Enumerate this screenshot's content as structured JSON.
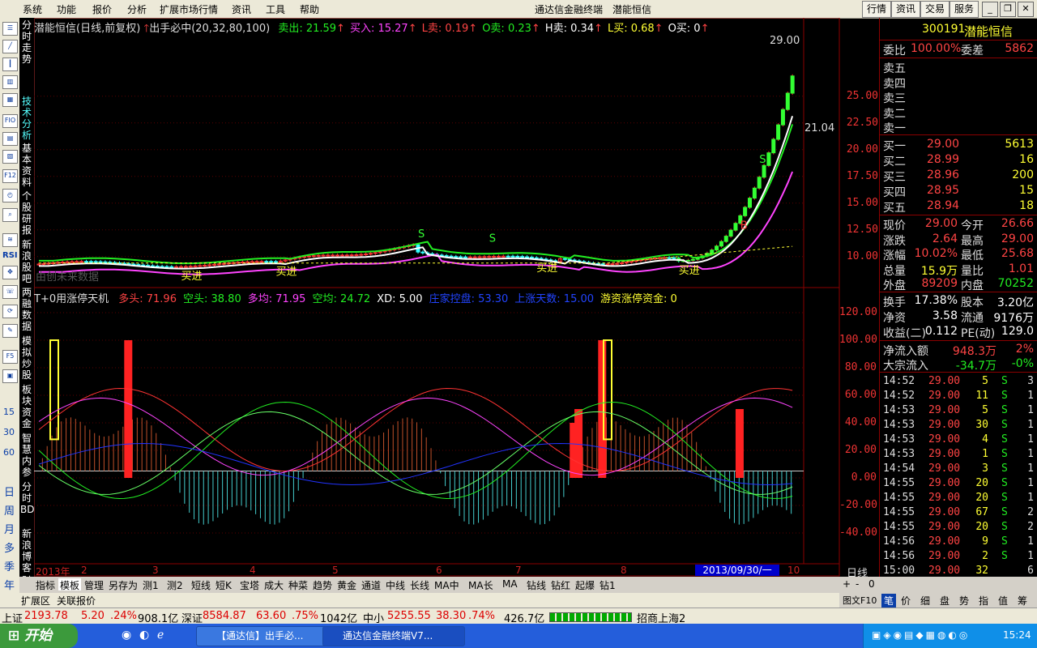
{
  "menu": [
    "系统",
    "功能",
    "报价",
    "分析",
    "扩展市场行情",
    "资讯",
    "工具",
    "帮助"
  ],
  "app_title": "通达信金融终端",
  "stock_title": "潜能恒信",
  "right_buttons": [
    "行情",
    "资讯",
    "交易",
    "服务"
  ],
  "main_header": {
    "name": "潜能恒信(日线,前复权)",
    "indicator": "出手必中(20,32,80,100)",
    "items": [
      {
        "label": "卖出: 21.59",
        "color": "#22ee22"
      },
      {
        "label": "买入: 15.27",
        "color": "#ff44ff"
      },
      {
        "label": "L卖: 0.19",
        "color": "#ff4444"
      },
      {
        "label": "O卖: 0.23",
        "color": "#22ee22"
      },
      {
        "label": "H卖: 0.34",
        "color": "#ffffff"
      },
      {
        "label": "L买: 0.68",
        "color": "#ffff33"
      },
      {
        "label": "O买: 0",
        "color": "#ffffff"
      }
    ]
  },
  "main_labels": {
    "high_price": "29.00",
    "mid_price": "21.04",
    "no_data": "由创未来数据"
  },
  "main_yaxis": [
    "25.00",
    "22.50",
    "20.00",
    "17.50",
    "15.00",
    "12.50",
    "10.00"
  ],
  "ind_header": {
    "name": "T+0用涨停天机",
    "items": [
      {
        "label": "多头: 71.96",
        "color": "#ff4444"
      },
      {
        "label": "空头: 38.80",
        "color": "#22ee22"
      },
      {
        "label": "多均: 71.95",
        "color": "#ff44ff"
      },
      {
        "label": "空均: 24.72",
        "color": "#22ee22"
      },
      {
        "label": "XD: 5.00",
        "color": "#ffffff"
      },
      {
        "label": "庄家控盘: 53.30",
        "color": "#2244ff"
      },
      {
        "label": "上涨天数: 15.00",
        "color": "#2244ff"
      },
      {
        "label": "游资涨停资金: 0",
        "color": "#ffff33"
      }
    ]
  },
  "ind_yaxis": [
    "120.00",
    "100.00",
    "80.00",
    "60.00",
    "40.00",
    "20.00",
    "0.00",
    "-20.00",
    "-40.00"
  ],
  "xaxis": [
    "2013年",
    "2",
    "3",
    "4",
    "5",
    "6",
    "7",
    "8",
    "10"
  ],
  "date_box": "2013/09/30/一",
  "period_label": "日线",
  "left_vtabs": [
    "分时走势",
    "技术分析",
    "基本资料",
    "个股研报",
    "新浪股吧",
    "两融数据",
    "模拟炒股",
    "板块资金",
    "智慧内参",
    "分时BD",
    "新浪博客",
    "财经"
  ],
  "left_icons": [
    "RSI",
    "F10",
    "F5",
    "15",
    "30",
    "60",
    "日",
    "周",
    "月",
    "多",
    "季",
    "年"
  ],
  "signal_labels": {
    "buy": "买进",
    "sell": "S",
    "b": "B"
  },
  "quote": {
    "code": "300191",
    "name": "潜能恒信",
    "weibi_label": "委比",
    "weibi": "100.00%",
    "weicha_label": "委差",
    "weicha": "5862",
    "sell_labels": [
      "卖五",
      "卖四",
      "卖三",
      "卖二",
      "卖一"
    ],
    "buys": [
      {
        "label": "买一",
        "price": "29.00",
        "vol": "5613"
      },
      {
        "label": "买二",
        "price": "28.99",
        "vol": "16"
      },
      {
        "label": "买三",
        "price": "28.96",
        "vol": "200"
      },
      {
        "label": "买四",
        "price": "28.95",
        "vol": "15"
      },
      {
        "label": "买五",
        "price": "28.94",
        "vol": "18"
      }
    ],
    "stats": [
      {
        "l1": "现价",
        "v1": "29.00",
        "l2": "今开",
        "v2": "26.66"
      },
      {
        "l1": "涨跌",
        "v1": "2.64",
        "l2": "最高",
        "v2": "29.00"
      },
      {
        "l1": "涨幅",
        "v1": "10.02%",
        "l2": "最低",
        "v2": "25.68"
      },
      {
        "l1": "总量",
        "v1": "15.9万",
        "l2": "量比",
        "v2": "1.01"
      },
      {
        "l1": "外盘",
        "v1": "89209",
        "l2": "内盘",
        "v2": "70252"
      }
    ],
    "stats2": [
      {
        "l1": "换手",
        "v1": "17.38%",
        "l2": "股本",
        "v2": "3.20亿"
      },
      {
        "l1": "净资",
        "v1": "3.58",
        "l2": "流通",
        "v2": "9176万"
      },
      {
        "l1": "收益(二)",
        "v1": "0.112",
        "l2": "PE(动)",
        "v2": "129.0"
      }
    ],
    "flow": [
      {
        "label": "净流入额",
        "v1": "948.3万",
        "v2": "2%"
      },
      {
        "label": "大宗流入",
        "v1": "-34.7万",
        "v2": "-0%"
      }
    ],
    "ticks": [
      {
        "t": "14:52",
        "p": "29.00",
        "v": "5",
        "s": "S",
        "n": "3"
      },
      {
        "t": "14:52",
        "p": "29.00",
        "v": "11",
        "s": "S",
        "n": "1"
      },
      {
        "t": "14:53",
        "p": "29.00",
        "v": "5",
        "s": "S",
        "n": "1"
      },
      {
        "t": "14:53",
        "p": "29.00",
        "v": "30",
        "s": "S",
        "n": "1"
      },
      {
        "t": "14:53",
        "p": "29.00",
        "v": "4",
        "s": "S",
        "n": "1"
      },
      {
        "t": "14:53",
        "p": "29.00",
        "v": "1",
        "s": "S",
        "n": "1"
      },
      {
        "t": "14:54",
        "p": "29.00",
        "v": "3",
        "s": "S",
        "n": "1"
      },
      {
        "t": "14:55",
        "p": "29.00",
        "v": "20",
        "s": "S",
        "n": "1"
      },
      {
        "t": "14:55",
        "p": "29.00",
        "v": "20",
        "s": "S",
        "n": "1"
      },
      {
        "t": "14:55",
        "p": "29.00",
        "v": "67",
        "s": "S",
        "n": "2"
      },
      {
        "t": "14:55",
        "p": "29.00",
        "v": "20",
        "s": "S",
        "n": "2"
      },
      {
        "t": "14:56",
        "p": "29.00",
        "v": "9",
        "s": "S",
        "n": "1"
      },
      {
        "t": "14:56",
        "p": "29.00",
        "v": "2",
        "s": "S",
        "n": "1"
      },
      {
        "t": "15:00",
        "p": "29.00",
        "v": "32",
        "s": "",
        "n": "6"
      }
    ]
  },
  "bottom_tabs": [
    "指标",
    "模板",
    "管理",
    "另存为",
    "测1",
    "测2",
    "短线",
    "短K",
    "宝塔",
    "成大",
    "种菜",
    "趋势",
    "黄金",
    "通道",
    "中线",
    "长线",
    "MA中",
    "MA长",
    "MA",
    "钻线",
    "钻红",
    "起爆",
    "钻1"
  ],
  "bottom_left_tabs": [
    "扩展区",
    "关联报价"
  ],
  "right_strip_top": [
    "+",
    "-",
    "0"
  ],
  "right_strip_f10": "图文F10",
  "right_strip_tabs": [
    "笔",
    "价",
    "细",
    "盘",
    "势",
    "指",
    "值",
    "筹"
  ],
  "status": {
    "sh_label": "上证",
    "sh": "2193.78",
    "sh_chg": "5.20",
    "sh_pct": ".24%",
    "sh_amt": "908.1亿",
    "sz_label": "深证",
    "sz": "8584.87",
    "sz_chg": "63.60",
    "sz_pct": ".75%",
    "sz_amt": "1042亿",
    "zx_label": "中小",
    "zx": "5255.55",
    "zx_chg": "38.30",
    "zx_pct": ".74%",
    "zx_amt": "426.7亿",
    "broker": "招商上海2"
  },
  "taskbar": {
    "start": "开始",
    "items": [
      "【通达信】出手必...",
      "通达信金融终端V7..."
    ],
    "clock": "15:24"
  }
}
